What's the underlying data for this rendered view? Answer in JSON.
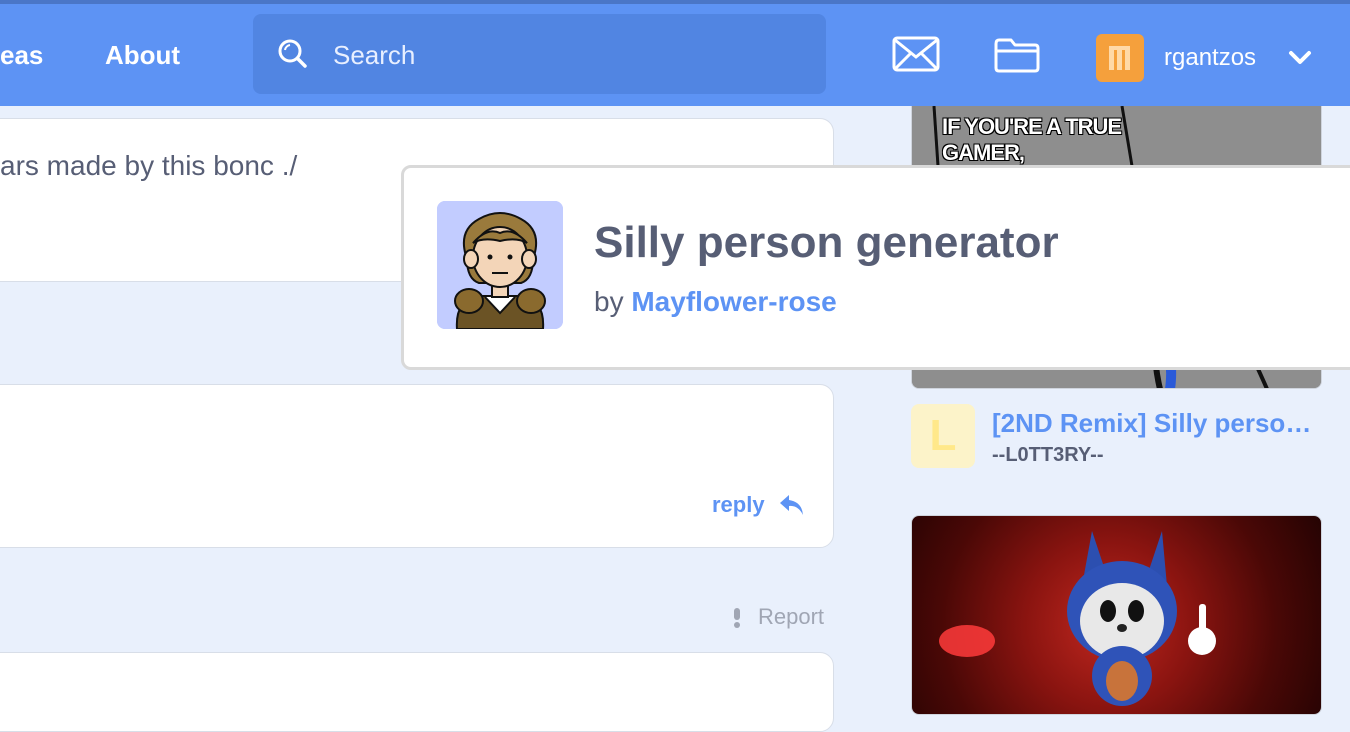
{
  "nav": {
    "ideas_label": "eas",
    "about_label": "About"
  },
  "search": {
    "placeholder": "Search"
  },
  "user": {
    "name": "rgantzos"
  },
  "icons": {
    "search": "search-icon",
    "messages": "envelope-icon",
    "mystuff": "folder-icon",
    "menu": "chevron-down-icon",
    "reply": "reply-arrow-icon",
    "report": "exclamation-icon"
  },
  "comments": {
    "first_text": "ars made by this bonc ./",
    "reply_label": "reply",
    "report_label": "Report"
  },
  "sidebar": {
    "top_thumb_text": "IF YOU'RE A TRUE GAMER,",
    "project": {
      "thumb_letter": "L",
      "title": "[2ND Remix] Silly person generator",
      "author": "--L0TT3RY--"
    }
  },
  "popup": {
    "title": "Silly person generator",
    "by_label": "by",
    "author": "Mayflower-rose"
  },
  "colors": {
    "header": "#5d93f4",
    "link": "#5d93f4",
    "text": "#575e75",
    "background": "#e9f0fc"
  }
}
